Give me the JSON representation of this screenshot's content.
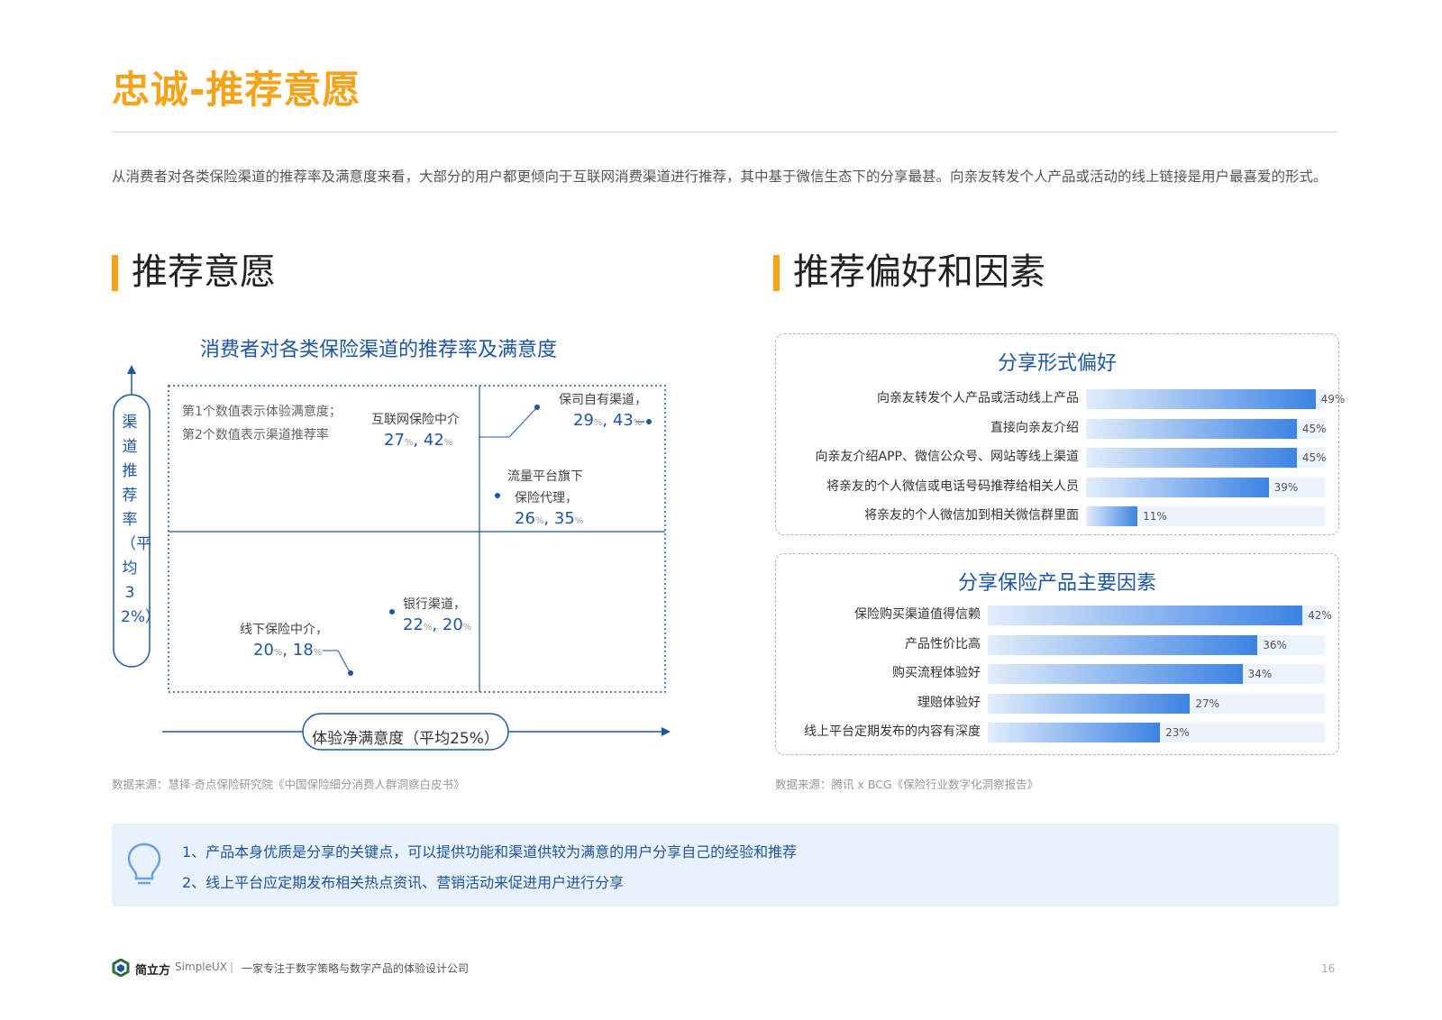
{
  "page": {
    "title": "忠诚-推荐意愿",
    "intro": "从消费者对各类保险渠道的推荐率及满意度来看，大部分的用户都更倾向于互联网消费渠道进行推荐，其中基于微信生态下的分享最甚。向亲友转发个人产品或活动的线上链接是用户最喜爱的形式。",
    "page_number": "16"
  },
  "left_section": {
    "heading": "推荐意愿",
    "source": "数据来源：慧择·奇点保险研究院《中国保险细分消费人群洞察白皮书》"
  },
  "right_section": {
    "heading": "推荐偏好和因素",
    "source": "数据来源：腾讯 x BCG《保险行业数字化洞察报告》"
  },
  "quadrant": {
    "title": "消费者对各类保险渠道的推荐率及满意度",
    "note_line1": "第1个数值表示体验满意度；",
    "note_line2": "第2个数值表示渠道推荐率",
    "y_axis_label": "渠道推荐率（平均32%）",
    "x_axis_label": "体验净满意度（平均25%）",
    "pct": "%",
    "points": [
      {
        "name_lines": [
          "互联网保险中介"
        ],
        "x": 27,
        "y": 42
      },
      {
        "name_lines": [
          "保司自有渠道，"
        ],
        "x": 29,
        "y": 43
      },
      {
        "name_lines": [
          "流量平台旗下",
          "保险代理，"
        ],
        "x": 26,
        "y": 35
      },
      {
        "name_lines": [
          "银行渠道，"
        ],
        "x": 22,
        "y": 20
      },
      {
        "name_lines": [
          "线下保险中介，"
        ],
        "x": 20,
        "y": 18
      }
    ]
  },
  "chart_data": [
    {
      "type": "scatter",
      "title": "消费者对各类保险渠道的推荐率及满意度",
      "xlabel": "体验净满意度（平均25%）",
      "ylabel": "渠道推荐率（平均32%）",
      "points": [
        {
          "label": "互联网保险中介",
          "x": 27,
          "y": 42
        },
        {
          "label": "保司自有渠道",
          "x": 29,
          "y": 43
        },
        {
          "label": "流量平台旗下保险代理",
          "x": 26,
          "y": 35
        },
        {
          "label": "银行渠道",
          "x": 22,
          "y": 20
        },
        {
          "label": "线下保险中介",
          "x": 20,
          "y": 18
        }
      ]
    },
    {
      "type": "bar",
      "title": "分享形式偏好",
      "categories": [
        "向亲友转发个人产品或活动线上产品",
        "直接向亲友介绍",
        "向亲友介绍APP、微信公众号、网站等线上渠道",
        "将亲友的个人微信或电话号码推荐给相关人员",
        "将亲友的个人微信加到相关微信群里面"
      ],
      "values": [
        49,
        45,
        45,
        39,
        11
      ],
      "value_labels": [
        "49%",
        "45%",
        "45%",
        "39%",
        "11%"
      ]
    },
    {
      "type": "bar",
      "title": "分享保险产品主要因素",
      "categories": [
        "保险购买渠道值得信赖",
        "产品性价比高",
        "购买流程体验好",
        "理赔体验好",
        "线上平台定期发布的内容有深度"
      ],
      "values": [
        42,
        36,
        34,
        27,
        23
      ],
      "value_labels": [
        "42%",
        "36%",
        "34%",
        "27%",
        "23%"
      ]
    }
  ],
  "tips": {
    "line1": "1、产品本身优质是分享的关键点，可以提供功能和渠道供较为满意的用户分享自己的经验和推荐",
    "line2": "2、线上平台应定期发布相关热点资讯、营销活动来促进用户进行分享"
  },
  "footer": {
    "brand": "简立方",
    "brand_en": "SimpleUX",
    "separator": "|",
    "slogan": "一家专注于数字策略与数字产品的体验设计公司"
  },
  "colors": {
    "accent": "#f5a31a",
    "primary": "#1e55a5",
    "bar_end": "#3c83e4"
  }
}
